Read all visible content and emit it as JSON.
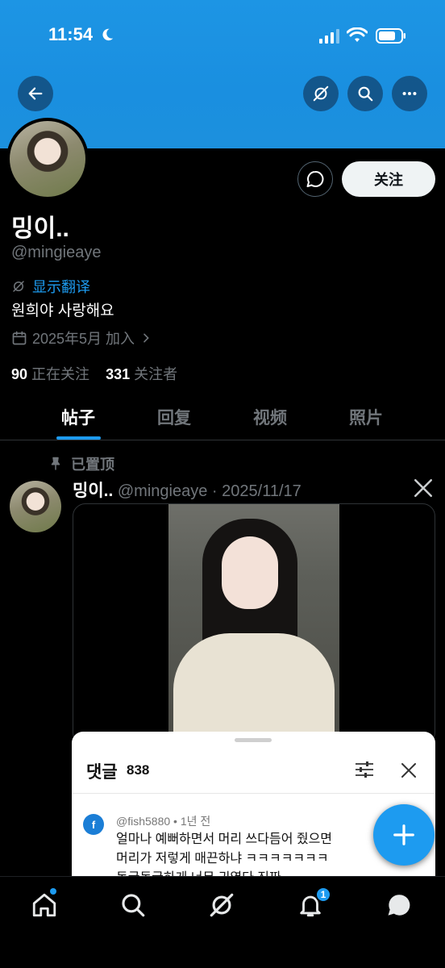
{
  "status_bar": {
    "time": "11:54"
  },
  "profile": {
    "name": "밍이..",
    "handle": "@mingieaye",
    "translate_label": "显示翻译",
    "bio": "원희야 사랑해요",
    "joined": "2025年5月 加入",
    "following_count": "90",
    "following_label": "正在关注",
    "followers_count": "331",
    "followers_label": "关注者",
    "follow_button": "关注"
  },
  "tabs": [
    {
      "label": "帖子",
      "active": true
    },
    {
      "label": "回复",
      "active": false
    },
    {
      "label": "视频",
      "active": false
    },
    {
      "label": "照片",
      "active": false
    }
  ],
  "post": {
    "pinned_label": "已置顶",
    "author_name": "밍이..",
    "author_handle": "@mingieaye",
    "separator": "·",
    "date": "2025/11/17"
  },
  "comments_sheet": {
    "title": "댓글",
    "count": "838",
    "comment": {
      "avatar_letter": "f",
      "user": "@fish5880",
      "time": "• 1년 전",
      "text_lines": [
        "얼마나 예뻐하면서 머리 쓰다듬어 줬으면",
        "머리가 저렇게 매끈하냐 ㅋㅋㅋㅋㅋㅋㅋ",
        "동글동글하게 너무 귀엽다 진짜"
      ]
    }
  },
  "bottom_nav": {
    "notifications_badge": "1"
  },
  "colors": {
    "accent": "#1d9bf0",
    "header_blue": "#1a8fe0",
    "background": "#000000",
    "secondary_text": "#71767b"
  },
  "icons": [
    "back-arrow-icon",
    "grok-icon",
    "search-icon",
    "more-icon",
    "message-icon",
    "translate-icon",
    "calendar-icon",
    "pin-icon",
    "x-logo-icon",
    "filter-icon",
    "close-icon",
    "plus-icon",
    "home-icon",
    "bell-icon",
    "chat-icon"
  ]
}
